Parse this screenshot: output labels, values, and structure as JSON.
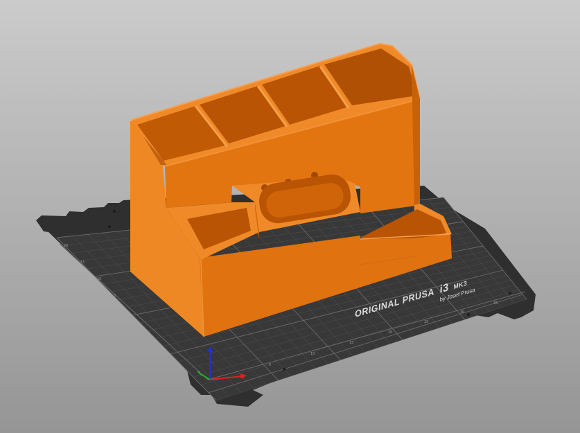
{
  "scene": {
    "bed_logo": {
      "brand": "ORIGINAL PRUSA",
      "model": "i3",
      "variant": "MK3",
      "byline": "by Josef Prusa"
    },
    "ticks": {
      "front": [
        "5",
        "10",
        "15",
        "20",
        "25",
        "30",
        "35"
      ],
      "right": [
        "5",
        "10",
        "15",
        "20"
      ],
      "left": [
        "5",
        "10",
        "15",
        "20"
      ]
    },
    "model_color": "#e8780c",
    "bed_color": "#2f2f2f",
    "axes": {
      "x_color": "#e02020",
      "y_color": "#20b020",
      "z_color": "#2030e0"
    }
  }
}
